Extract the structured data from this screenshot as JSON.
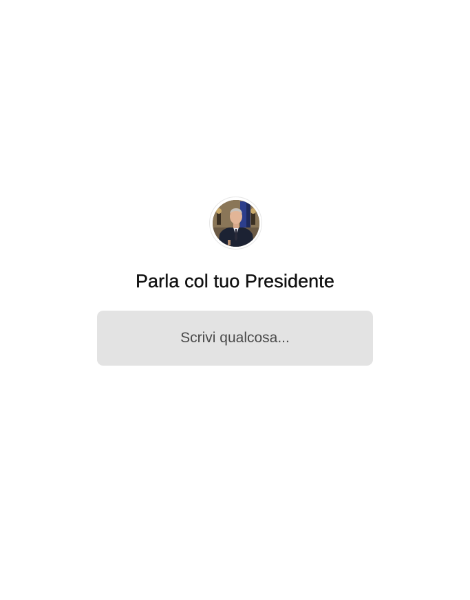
{
  "chat": {
    "avatar_icon": "president-avatar",
    "title": "Parla col tuo Presidente",
    "input": {
      "placeholder": "Scrivi qualcosa...",
      "value": ""
    }
  },
  "colors": {
    "background": "#ffffff",
    "input_background": "#e3e3e3",
    "title_text": "#111111",
    "placeholder_text": "#4a4a4a"
  }
}
